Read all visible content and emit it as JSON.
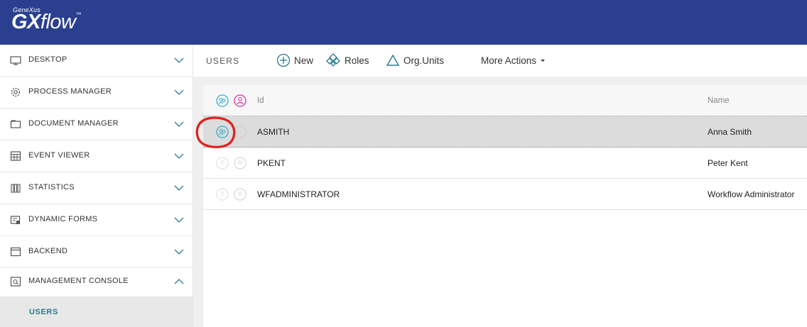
{
  "header": {
    "brand_small": "GeneXus",
    "brand_gx": "GX",
    "brand_flow": "flow",
    "brand_tm": "™",
    "color": "#2a3f8f"
  },
  "sidebar": {
    "items": [
      {
        "label": "DESKTOP",
        "icon": "monitor-icon",
        "chevron": "chevron-down-icon"
      },
      {
        "label": "PROCESS MANAGER",
        "icon": "gear-icon",
        "chevron": "chevron-down-icon"
      },
      {
        "label": "DOCUMENT MANAGER",
        "icon": "folder-icon",
        "chevron": "chevron-down-icon"
      },
      {
        "label": "EVENT VIEWER",
        "icon": "calendar-icon",
        "chevron": "chevron-down-icon"
      },
      {
        "label": "STATISTICS",
        "icon": "bar-chart-icon",
        "chevron": "chevron-down-icon"
      },
      {
        "label": "DYNAMIC FORMS",
        "icon": "form-icon",
        "chevron": "chevron-down-icon"
      },
      {
        "label": "BACKEND",
        "icon": "window-icon",
        "chevron": "chevron-down-icon"
      },
      {
        "label": "MANAGEMENT CONSOLE",
        "icon": "console-icon",
        "chevron": "chevron-up-icon"
      }
    ],
    "sub_item": "USERS",
    "accent": "#2a7a8c"
  },
  "toolbar": {
    "title": "USERS",
    "new_label": "New",
    "roles_label": "Roles",
    "org_units_label": "Org.Units",
    "more_actions_label": "More Actions"
  },
  "grid": {
    "headers": {
      "id": "Id",
      "name": "Name"
    },
    "rows": [
      {
        "id": "ASMITH",
        "name": "Anna Smith",
        "selected": true
      },
      {
        "id": "PKENT",
        "name": "Peter Kent",
        "selected": false
      },
      {
        "id": "WFADMINISTRATOR",
        "name": "Workflow Administrator",
        "selected": false
      }
    ]
  },
  "colors": {
    "teal_icon": "#3aaecb",
    "pink_icon": "#d633a6",
    "annotation": "#e02020"
  }
}
